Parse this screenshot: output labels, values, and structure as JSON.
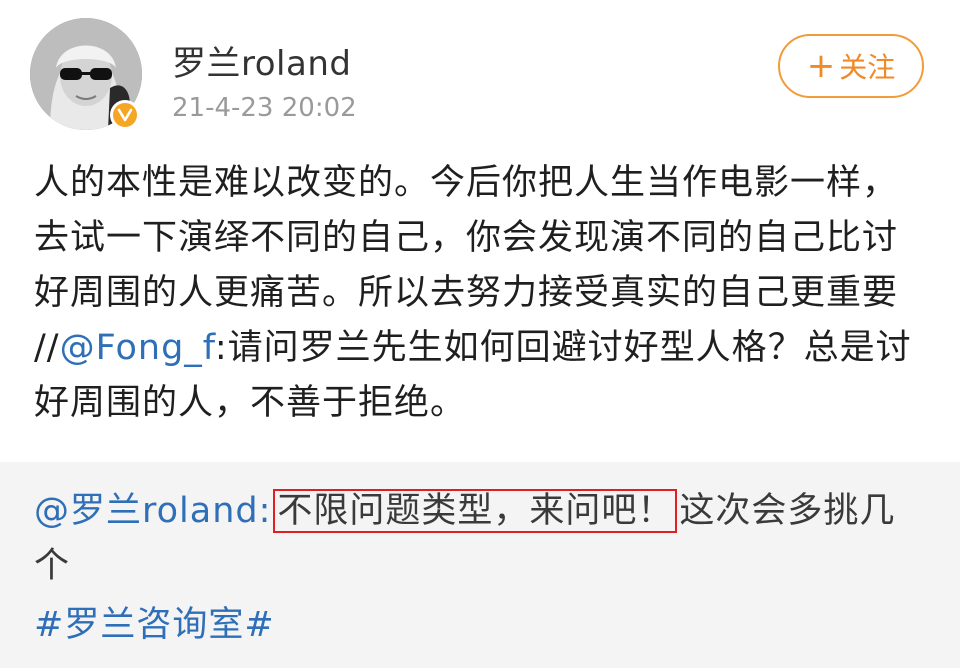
{
  "post": {
    "author": {
      "name": "罗兰roland",
      "timestamp": "21-4-23 20:02",
      "verified_icon": "verified-v-badge",
      "avatar_icon": "avatar-photo"
    },
    "follow_label": "关注",
    "follow_icon": "plus-icon",
    "body": {
      "text_main": "人的本性是难以改变的。今后你把人生当作电影一样，去试一下演绎不同的自己，你会发现演不同的自己比讨好周围的人更痛苦。所以去努力接受真实的自己更重要 //",
      "mention": "@Fong_f",
      "text_after_mention": ":请问罗兰先生如何回避讨好型人格？总是讨好周围的人，不善于拒绝。"
    }
  },
  "repost": {
    "mention": "@罗兰roland",
    "separator": ":",
    "highlighted_text": "不限问题类型，来问吧！",
    "text_after": "这次会多挑几个",
    "topic": "#罗兰咨询室#"
  },
  "colors": {
    "accent_orange": "#f08a24",
    "link_blue": "#2f6fb8",
    "highlight_red": "#e02020",
    "repost_bg": "#f4f4f4"
  }
}
